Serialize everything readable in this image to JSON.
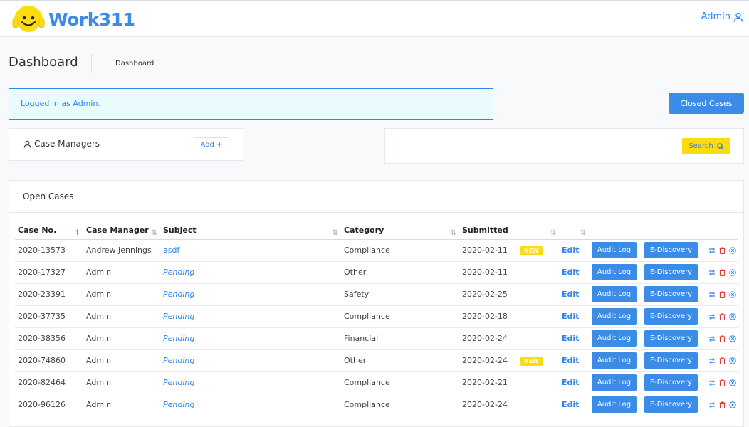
{
  "header": {
    "logo_text": "Work311",
    "admin_label": "Admin"
  },
  "page": {
    "title": "Dashboard",
    "breadcrumb": "Dashboard"
  },
  "alert": {
    "text": "Logged in as Admin."
  },
  "closed_cases_label": "Closed Cases",
  "case_managers": {
    "title": "Case Managers",
    "add_label": "Add +"
  },
  "search": {
    "button_label": "Search"
  },
  "open_cases": {
    "title": "Open Cases",
    "columns": [
      "Case No.",
      "Case Manager",
      "Subject",
      "Category",
      "Submitted"
    ],
    "edit_label": "Edit",
    "audit_label": "Audit Log",
    "ediscovery_label": "E-Discovery",
    "new_label": "NEW",
    "rows": [
      {
        "case_no": "2020-13573",
        "manager": "Andrew Jennings",
        "subject": "asdf",
        "pending": false,
        "category": "Compliance",
        "submitted": "2020-02-11",
        "is_new": true
      },
      {
        "case_no": "2020-17327",
        "manager": "Admin",
        "subject": "Pending",
        "pending": true,
        "category": "Other",
        "submitted": "2020-02-11",
        "is_new": false
      },
      {
        "case_no": "2020-23391",
        "manager": "Admin",
        "subject": "Pending",
        "pending": true,
        "category": "Safety",
        "submitted": "2020-02-25",
        "is_new": false
      },
      {
        "case_no": "2020-37735",
        "manager": "Admin",
        "subject": "Pending",
        "pending": true,
        "category": "Compliance",
        "submitted": "2020-02-18",
        "is_new": false
      },
      {
        "case_no": "2020-38356",
        "manager": "Admin",
        "subject": "Pending",
        "pending": true,
        "category": "Financial",
        "submitted": "2020-02-24",
        "is_new": false
      },
      {
        "case_no": "2020-74860",
        "manager": "Admin",
        "subject": "Pending",
        "pending": true,
        "category": "Other",
        "submitted": "2020-02-24",
        "is_new": true
      },
      {
        "case_no": "2020-82464",
        "manager": "Admin",
        "subject": "Pending",
        "pending": true,
        "category": "Compliance",
        "submitted": "2020-02-21",
        "is_new": false
      },
      {
        "case_no": "2020-96126",
        "manager": "Admin",
        "subject": "Pending",
        "pending": true,
        "category": "Compliance",
        "submitted": "2020-02-24",
        "is_new": false
      }
    ]
  },
  "colors": {
    "accent": "#3b8ce6",
    "link": "#2f86eb",
    "yellow": "#fcdb0f",
    "danger": "#e53935"
  }
}
